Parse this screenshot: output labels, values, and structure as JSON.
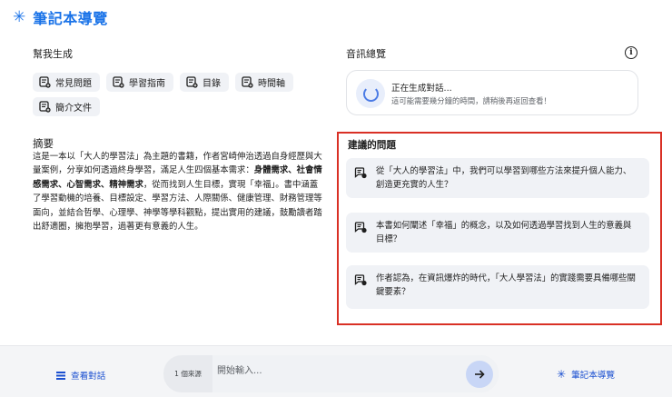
{
  "header": {
    "icon": "sparkle-icon",
    "title": "筆記本導覽"
  },
  "help": {
    "label": "幫我生成",
    "chips": [
      {
        "label": "常見問題",
        "icon": "note-icon"
      },
      {
        "label": "學習指南",
        "icon": "note-icon"
      },
      {
        "label": "目錄",
        "icon": "note-icon"
      },
      {
        "label": "時間軸",
        "icon": "note-icon"
      },
      {
        "label": "簡介文件",
        "icon": "note-icon"
      }
    ]
  },
  "summary": {
    "title": "摘要",
    "parts": [
      "這是一本以「大人的學習法」為主題的書籍，作者宮崎伸治透過自身經歷與大量案例，分享如何透過終身學習，滿足人生四個基本需求：",
      "身體需求、社會情感需求、心智需求、精神需求",
      "，從而找到人生目標，實現「幸福」。書中涵蓋了學習動機的培養、目標設定、學習方法、人際關係、健康管理、財務管理等面向，並結合哲學、心理學、神學等學科觀點，提出實用的建議，鼓勵讀者踏出舒適圈，擁抱學習，過著更有意義的人生。"
    ]
  },
  "audio": {
    "label": "音訊總覽",
    "status_title": "正在生成對話...",
    "status_sub": "這可能需要幾分鐘的時間，請稍後再返回查看！"
  },
  "suggested": {
    "title": "建議的問題",
    "questions": [
      "從「大人的學習法」中，我們可以學習到哪些方法來提升個人能力、創造更充實的人生？",
      "本書如何闡述「幸福」的概念，以及如何透過學習找到人生的意義與目標？",
      "作者認為，在資訊爆炸的時代，「大人學習法」的實踐需要具備哪些關鍵要素？"
    ]
  },
  "bottom": {
    "view_chat": "查看對話",
    "source_count": "1 個來源",
    "input_placeholder": "開始輸入...",
    "notebook_guide": "筆記本導覽"
  },
  "colors": {
    "accent": "#1a73e8",
    "highlight_border": "#d93025",
    "chip_bg": "#f0f2f6"
  }
}
